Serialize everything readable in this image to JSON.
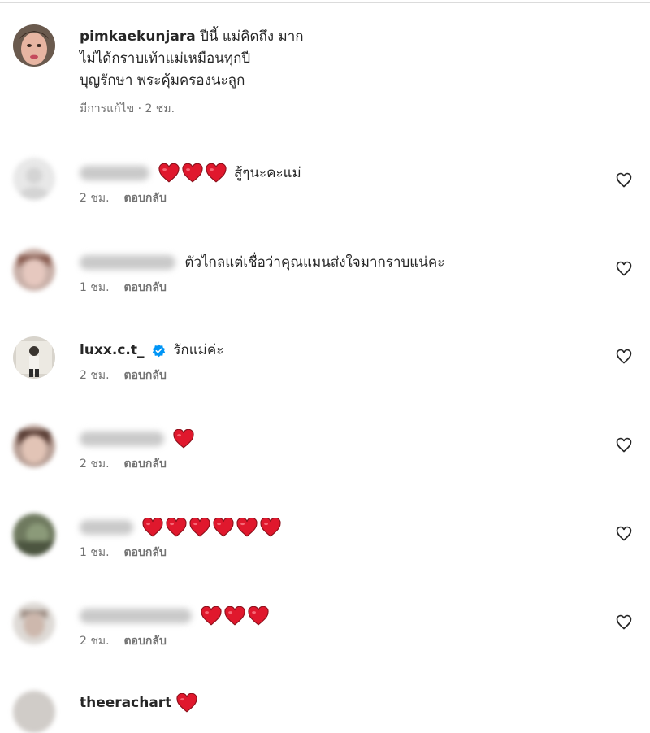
{
  "comments": [
    {
      "username": "pimkaekunjara",
      "lines": [
        "ปีนี้ แม่คิดถึง มาก",
        "ไม่ได้กราบเท้าแม่เหมือนทุกปี",
        "บุญรักษา พระคุ้มครองนะลูก"
      ],
      "time": "มีการแก้ไข · 2 ชม."
    },
    {
      "text": "สู้ๆนะคะแม่",
      "time": "2 ชม.",
      "reply": "ตอบกลับ",
      "hearts": 3
    },
    {
      "text": "ตัวไกลแต่เชื่อว่าคุณแมนส่งใจมากราบแน่คะ",
      "time": "1 ชม.",
      "reply": "ตอบกลับ",
      "hearts": 0
    },
    {
      "username": "luxx.c.t_",
      "text": "รักแม่ค่ะ",
      "time": "2 ชม.",
      "reply": "ตอบกลับ",
      "hearts": 0,
      "verified": true
    },
    {
      "text": "",
      "time": "2 ชม.",
      "reply": "ตอบกลับ",
      "hearts": 1
    },
    {
      "text": "",
      "time": "1 ชม.",
      "reply": "ตอบกลับ",
      "hearts": 6
    },
    {
      "text": "",
      "time": "2 ชม.",
      "reply": "ตอบกลับ",
      "hearts": 3
    },
    {
      "username": "theerachart",
      "hearts": 1
    }
  ],
  "icons": {
    "like": "heart-outline-icon",
    "verified": "verified-badge-icon",
    "emoji": "red-heart-emoji"
  },
  "colors": {
    "verified": "#0095f6",
    "heart": "#e0182d"
  }
}
